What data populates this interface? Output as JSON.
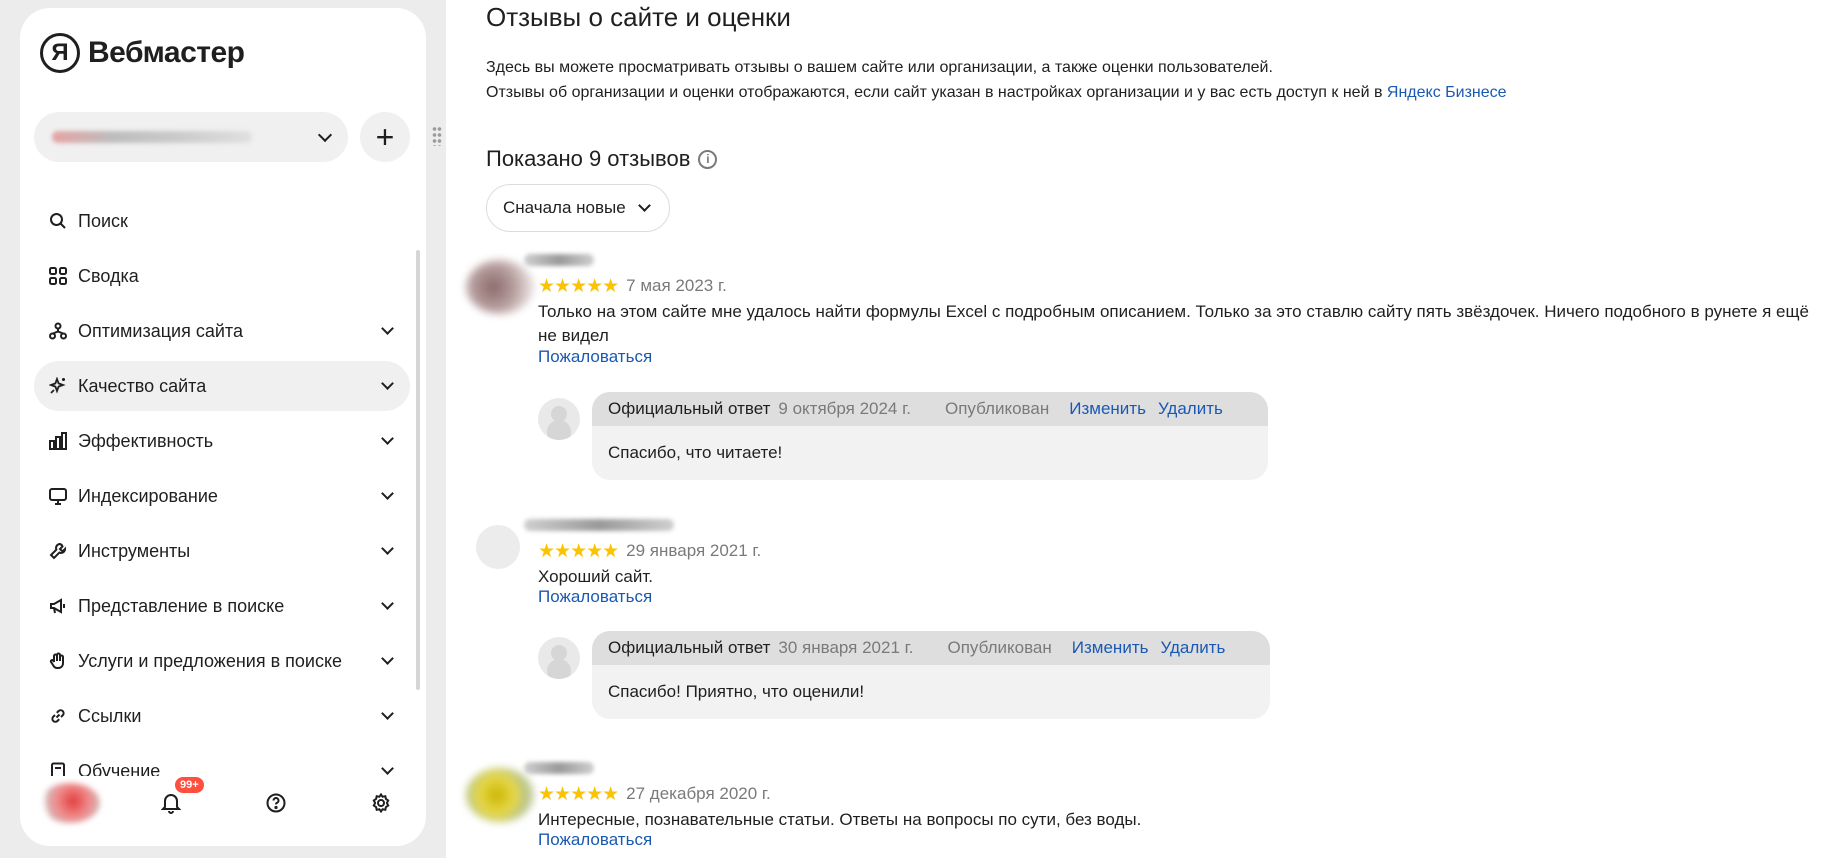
{
  "sidebar": {
    "brand": {
      "mark": "Я",
      "name": "Вебмастер"
    },
    "add_button": "+",
    "items": [
      {
        "label": "Поиск",
        "icon": "search-icon",
        "has_chevron": false
      },
      {
        "label": "Сводка",
        "icon": "grid-icon",
        "has_chevron": false
      },
      {
        "label": "Оптимизация сайта",
        "icon": "sitemap-icon",
        "has_chevron": true
      },
      {
        "label": "Качество сайта",
        "icon": "sparkles-icon",
        "has_chevron": true,
        "active": true
      },
      {
        "label": "Эффективность",
        "icon": "bar-chart-icon",
        "has_chevron": true
      },
      {
        "label": "Индексирование",
        "icon": "monitor-icon",
        "has_chevron": true
      },
      {
        "label": "Инструменты",
        "icon": "wrench-icon",
        "has_chevron": true
      },
      {
        "label": "Представление в поиске",
        "icon": "megaphone-icon",
        "has_chevron": true
      },
      {
        "label": "Услуги и предложения в поиске",
        "icon": "hand-icon",
        "has_chevron": true
      },
      {
        "label": "Ссылки",
        "icon": "link-icon",
        "has_chevron": true
      },
      {
        "label": "Обучение",
        "icon": "book-icon",
        "has_chevron": true
      }
    ],
    "notifications_badge": "99+"
  },
  "main": {
    "title": "Отзывы о сайте и оценки",
    "intro_line1": "Здесь вы можете просматривать отзывы о вашем сайте или организации, а также оценки пользователей.",
    "intro_line2": "Отзывы об организации и оценки отображаются, если сайт указан в настройках организации и у вас есть доступ к ней в ",
    "intro_link": "Яндекс Бизнесе",
    "shown_count": "Показано 9 отзывов",
    "sort_label": "Сначала новые",
    "star_color": "#fcc302",
    "link_color": "#1a59b3",
    "complain_label": "Пожаловаться",
    "reviews": [
      {
        "rating": 5,
        "date": "7 мая 2023 г.",
        "text": "Только на этом сайте мне удалось найти формулы Excel с подробным описанием. Только за это ставлю сайту пять звёздочек. Ничего подобного в рунете я ещё не видел",
        "reply": {
          "label": "Официальный ответ",
          "date": "9 октября 2024 г.",
          "status": "Опубликован",
          "edit": "Изменить",
          "delete": "Удалить",
          "text": "Спасибо, что читаете!"
        }
      },
      {
        "rating": 5,
        "date": "29 января 2021 г.",
        "text": "Хороший сайт.",
        "reply": {
          "label": "Официальный ответ",
          "date": "30 января 2021 г.",
          "status": "Опубликован",
          "edit": "Изменить",
          "delete": "Удалить",
          "text": "Спасибо! Приятно, что оценили!"
        }
      },
      {
        "rating": 5,
        "date": "27 декабря 2020 г.",
        "text": "Интересные, познавательные статьи. Ответы на вопросы по сути, без воды."
      }
    ]
  }
}
